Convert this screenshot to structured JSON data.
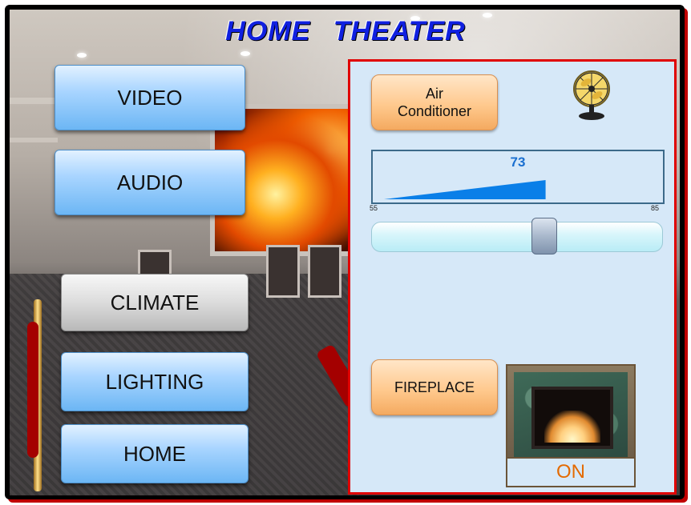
{
  "app": {
    "title": "HOME THEATER"
  },
  "nav": [
    {
      "label": "VIDEO",
      "active": false
    },
    {
      "label": "AUDIO",
      "active": false
    },
    {
      "label": "CLIMATE",
      "active": true
    },
    {
      "label": "LIGHTING",
      "active": false
    },
    {
      "label": "HOME",
      "active": false
    }
  ],
  "climate": {
    "ac_button_line1": "Air",
    "ac_button_line2": "Conditioner",
    "fan_icon": "fan-icon",
    "temperature": {
      "value": "73",
      "min_label": "55",
      "max_label": "85",
      "value_num": 73,
      "min_num": 55,
      "max_num": 85
    },
    "slider_fraction": 0.6,
    "fireplace_button": "FIREPLACE",
    "fireplace_status": "ON"
  },
  "colors": {
    "title": "#1020e0",
    "panel_border": "#e00000",
    "panel_bg": "#d6e8f8",
    "gauge_fill": "#0a7fe8",
    "status_text": "#e46a00"
  }
}
